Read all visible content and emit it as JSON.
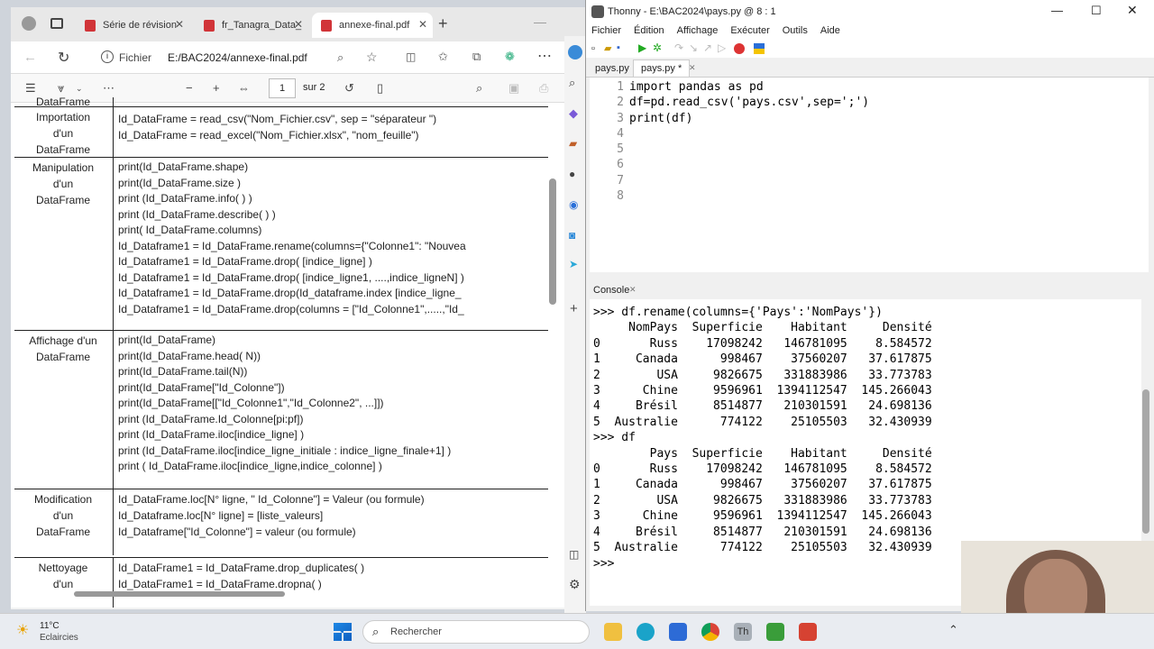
{
  "browser": {
    "tabs": [
      "Série de révision",
      "fr_Tanagra_Data_",
      "annexe-final.pdf"
    ],
    "address_label": "Fichier",
    "address": "E:/BAC2024/annexe-final.pdf",
    "page_current": "1",
    "page_total": "sur 2"
  },
  "pdf": {
    "rows": [
      {
        "label": "DataFrame",
        "lines": []
      },
      {
        "label": "Importation\nd'un\nDataFrame",
        "lines": [
          "Id_DataFrame = read_csv(\"Nom_Fichier.csv\", sep = \"séparateur \")",
          "Id_DataFrame = read_excel(\"Nom_Fichier.xlsx\", \"nom_feuille\")"
        ]
      },
      {
        "label": "Manipulation\nd'un\nDataFrame",
        "lines": [
          "print(Id_DataFrame.shape)",
          "print(Id_DataFrame.size )",
          " print (Id_DataFrame.info( )  )",
          " print (Id_DataFrame.describe( ) )",
          "print( Id_DataFrame.columns)",
          "Id_Dataframe1 = Id_DataFrame.rename(columns={\"Colonne1\": \"Nouvea",
          "Id_Dataframe1 = Id_DataFrame.drop( [indice_ligne] )",
          "Id_Dataframe1 = Id_DataFrame.drop( [indice_ligne1, ....,indice_ligneN] )",
          "Id_Dataframe1 = Id_DataFrame.drop(Id_dataframe.index [indice_ligne_",
          "Id_Dataframe1 = Id_DataFrame.drop(columns =  [\"Id_Colonne1\",.....,\"Id_"
        ]
      },
      {
        "label": "Affichage d'un\nDataFrame",
        "lines": [
          "print(Id_DataFrame)",
          "print(Id_DataFrame.head( N))",
          "print(Id_DataFrame.tail(N))",
          "print(Id_DataFrame[\"Id_Colonne\"])",
          "print(Id_DataFrame[[\"Id_Colonne1\",\"Id_Colonne2\", ...]])",
          "print (Id_DataFrame.Id_Colonne[pi:pf])",
          "print (Id_DataFrame.iloc[indice_ligne] )",
          "print (Id_DataFrame.iloc[indice_ligne_initiale : indice_ligne_finale+1] )",
          "print ( Id_DataFrame.iloc[indice_ligne,indice_colonne] )"
        ]
      },
      {
        "label": "Modification\nd'un\nDataFrame",
        "lines": [
          "Id_DataFrame.loc[N° ligne, \" Id_Colonne\"]  =  Valeur  (ou  formule)",
          "Id_Dataframe.loc[N° ligne] = [liste_valeurs]",
          "Id_Dataframe[\"Id_Colonne\"] = valeur  (ou    formule)"
        ]
      },
      {
        "label": "Nettoyage\nd'un",
        "lines": [
          "Id_DataFrame1 = Id_DataFrame.drop_duplicates( )",
          "Id_DataFrame1 = Id_DataFrame.dropna( )"
        ]
      }
    ]
  },
  "thonny": {
    "title": "Thonny  -  E:\\BAC2024\\pays.py  @  8 : 1",
    "menu": [
      "Fichier",
      "Édition",
      "Affichage",
      "Exécuter",
      "Outils",
      "Aide"
    ],
    "tabs": [
      "pays.py",
      "pays.py *"
    ],
    "line_numbers": "1\n2\n3\n4\n5\n6\n7\n8",
    "code": "import pandas as pd\ndf=pd.read_csv('pays.csv',sep=';')\nprint(df)",
    "console_label": "Console",
    "console": ">>> df.rename(columns={'Pays':'NomPays'})\n     NomPays  Superficie    Habitant     Densité\n0       Russ    17098242   146781095    8.584572\n1     Canada      998467    37560207   37.617875\n2        USA     9826675   331883986   33.773783\n3      Chine     9596961  1394112547  145.266043\n4     Brésil     8514877   210301591   24.698136\n5  Australie      774122    25105503   32.430939\n>>> df\n        Pays  Superficie    Habitant     Densité\n0       Russ    17098242   146781095    8.584572\n1     Canada      998467    37560207   37.617875\n2        USA     9826675   331883986   33.773783\n3      Chine     9596961  1394112547  145.266043\n4     Brésil     8514877   210301591   24.698136\n5  Australie      774122    25105503   32.430939\n>>> "
  },
  "taskbar": {
    "weather_temp": "11°C",
    "weather_desc": "Eclaircies",
    "search_placeholder": "Rechercher"
  }
}
